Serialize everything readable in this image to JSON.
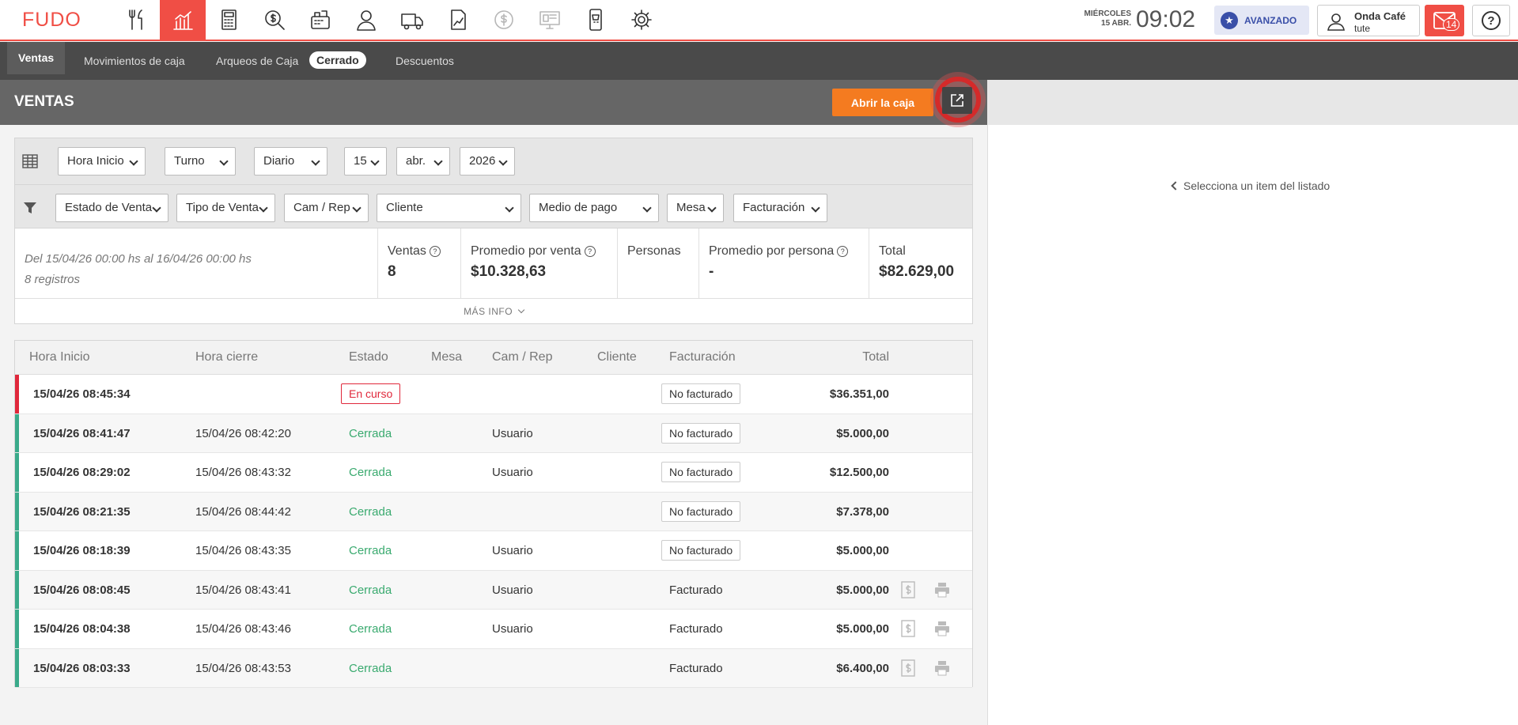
{
  "app": {
    "logo": "FUDO",
    "nav_icons": [
      {
        "name": "utensils-icon"
      },
      {
        "name": "chart-icon",
        "active": true
      },
      {
        "name": "calculator-icon"
      },
      {
        "name": "money-search-icon"
      },
      {
        "name": "cash-register-icon"
      },
      {
        "name": "user-icon"
      },
      {
        "name": "truck-icon"
      },
      {
        "name": "report-icon"
      },
      {
        "name": "dollar-circle-icon",
        "disabled": true
      },
      {
        "name": "monitor-icon",
        "disabled": true
      },
      {
        "name": "mobile-cart-icon"
      },
      {
        "name": "gear-icon"
      }
    ],
    "accent": "#f04e45"
  },
  "header": {
    "day": "MIÉRCOLES",
    "date": "15 ABR.",
    "time": "09:02",
    "plan": "AVANZADO",
    "user_name": "Onda Café",
    "user_sub": "tute",
    "mail_count": "14",
    "help": "?"
  },
  "subnav": {
    "tabs": [
      "Ventas",
      "Movimientos de caja",
      "Arqueos de Caja",
      "Descuentos"
    ],
    "status_pill": "Cerrado"
  },
  "page": {
    "title": "VENTAS",
    "open_button": "Abrir la caja",
    "right_hint": "Selecciona un item del listado"
  },
  "filters": {
    "row1": [
      "Hora Inicio",
      "Turno",
      "Diario",
      "15",
      "abr.",
      "2026"
    ],
    "row2": [
      "Estado de Venta",
      "Tipo de Venta",
      "Cam / Rep",
      "Cliente",
      "Medio de pago",
      "Mesa",
      "Facturación"
    ]
  },
  "summary": {
    "range": "Del 15/04/26 00:00 hs al 16/04/26 00:00 hs",
    "count": "8 registros",
    "stats": [
      {
        "label": "Ventas",
        "value": "8",
        "info": true
      },
      {
        "label": "Promedio por venta",
        "value": "$10.328,63",
        "info": true
      },
      {
        "label": "Personas",
        "value": "",
        "info": false
      },
      {
        "label": "Promedio por persona",
        "value": "-",
        "info": true
      },
      {
        "label": "Total",
        "value": "$82.629,00",
        "info": false
      }
    ],
    "more": "MÁS INFO"
  },
  "table": {
    "columns": [
      "Hora Inicio",
      "Hora cierre",
      "Estado",
      "Mesa",
      "Cam / Rep",
      "Cliente",
      "Facturación",
      "Total"
    ],
    "rows": [
      {
        "start": "15/04/26 08:45:34",
        "end": "",
        "status": "En curso",
        "mesa": "",
        "cam": "",
        "cliente": "",
        "fact": "No facturado",
        "total": "$36.351,00"
      },
      {
        "start": "15/04/26 08:41:47",
        "end": "15/04/26 08:42:20",
        "status": "Cerrada",
        "mesa": "",
        "cam": "Usuario",
        "cliente": "",
        "fact": "No facturado",
        "total": "$5.000,00"
      },
      {
        "start": "15/04/26 08:29:02",
        "end": "15/04/26 08:43:32",
        "status": "Cerrada",
        "mesa": "",
        "cam": "Usuario",
        "cliente": "",
        "fact": "No facturado",
        "total": "$12.500,00"
      },
      {
        "start": "15/04/26 08:21:35",
        "end": "15/04/26 08:44:42",
        "status": "Cerrada",
        "mesa": "",
        "cam": "",
        "cliente": "",
        "fact": "No facturado",
        "total": "$7.378,00"
      },
      {
        "start": "15/04/26 08:18:39",
        "end": "15/04/26 08:43:35",
        "status": "Cerrada",
        "mesa": "",
        "cam": "Usuario",
        "cliente": "",
        "fact": "No facturado",
        "total": "$5.000,00"
      },
      {
        "start": "15/04/26 08:08:45",
        "end": "15/04/26 08:43:41",
        "status": "Cerrada",
        "mesa": "",
        "cam": "Usuario",
        "cliente": "",
        "fact": "Facturado",
        "total": "$5.000,00"
      },
      {
        "start": "15/04/26 08:04:38",
        "end": "15/04/26 08:43:46",
        "status": "Cerrada",
        "mesa": "",
        "cam": "Usuario",
        "cliente": "",
        "fact": "Facturado",
        "total": "$5.000,00"
      },
      {
        "start": "15/04/26 08:03:33",
        "end": "15/04/26 08:43:53",
        "status": "Cerrada",
        "mesa": "",
        "cam": "",
        "cliente": "",
        "fact": "Facturado",
        "total": "$6.400,00"
      }
    ]
  }
}
